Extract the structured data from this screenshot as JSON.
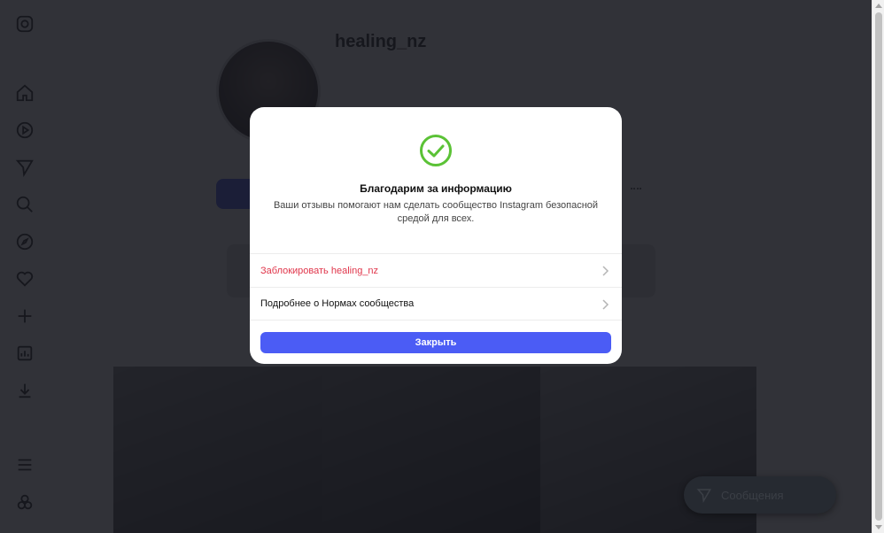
{
  "profile": {
    "username": "healing_nz",
    "subtitle": "",
    "stats": ""
  },
  "messages_pill": {
    "label": "Сообщения",
    "icon": "send-icon"
  },
  "sidebar": {
    "icons": [
      "instagram-logo-icon",
      "home-icon",
      "reels-icon",
      "send-icon",
      "search-icon",
      "explore-icon",
      "heart-icon",
      "create-icon",
      "dashboard-icon",
      "download-icon",
      "menu-icon",
      "threads-icon"
    ]
  },
  "modal": {
    "check_icon": "check-circle-icon",
    "check_color": "#5bc236",
    "title": "Благодарим за информацию",
    "text": "Ваши отзывы помогают нам сделать сообщество Instagram безопасной средой для всех.",
    "block_label": "Заблокировать healing_nz",
    "block_color": "#e0364b",
    "rules_label": "Подробнее о Нормах сообщества",
    "close_label": "Закрыть",
    "accent": "#4b5cf5"
  }
}
